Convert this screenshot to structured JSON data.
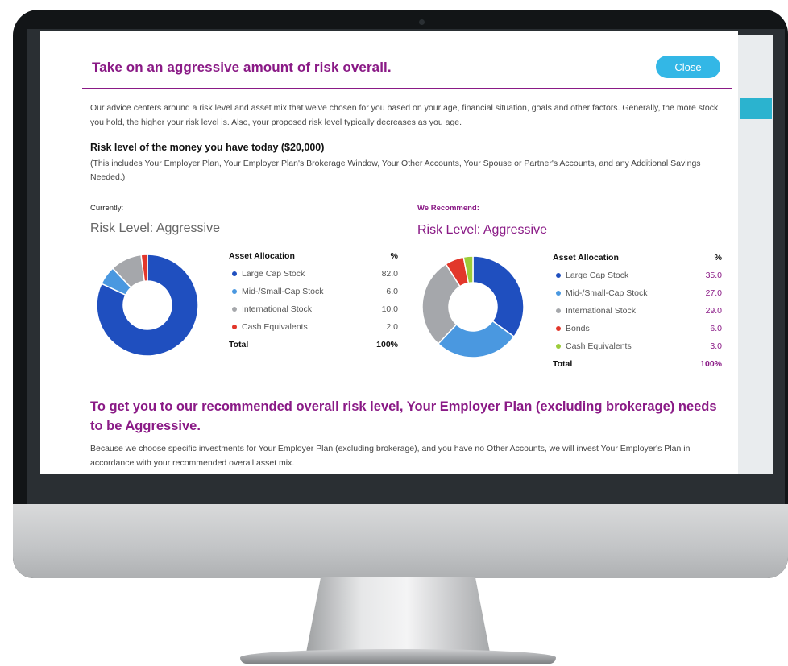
{
  "modal": {
    "title": "Take on an aggressive amount of risk overall.",
    "close_label": "Close",
    "intro": "Our advice centers around a risk level and asset mix that we've chosen for you based on your age, financial situation, goals and other factors. Generally, the more stock you hold, the higher your risk level is. Also, your proposed risk level typically decreases as you age.",
    "section_heading": "Risk level of the money you have today ($20,000)",
    "section_note": "(This includes Your Employer Plan, Your Employer Plan's Brokerage Window, Your Other Accounts, Your Spouse or Partner's Accounts, and any Additional Savings Needed.)",
    "recommend_heading": "To get you to our recommended overall risk level, Your Employer Plan (excluding brokerage) needs to be Aggressive.",
    "footer_text": "Because we choose specific investments for Your Employer Plan (excluding brokerage), and you have no Other Accounts, we will invest Your Employer's Plan in accordance with your recommended overall asset mix."
  },
  "current": {
    "label": "Currently:",
    "risk_level": "Risk Level: Aggressive",
    "table_header": "Asset Allocation",
    "pct_header": "%",
    "total_label": "Total",
    "total_value": "100%",
    "rows": [
      {
        "name": "Large Cap Stock",
        "pct": "82.0",
        "value": 82.0,
        "color": "#1f4fbf"
      },
      {
        "name": "Mid-/Small-Cap Stock",
        "pct": "6.0",
        "value": 6.0,
        "color": "#4a98e0"
      },
      {
        "name": "International Stock",
        "pct": "10.0",
        "value": 10.0,
        "color": "#a5a7ab"
      },
      {
        "name": "Cash Equivalents",
        "pct": "2.0",
        "value": 2.0,
        "color": "#e2372b"
      }
    ]
  },
  "recommended": {
    "label": "We Recommend:",
    "risk_level": "Risk Level: Aggressive",
    "table_header": "Asset Allocation",
    "pct_header": "%",
    "total_label": "Total",
    "total_value": "100%",
    "rows": [
      {
        "name": "Large Cap Stock",
        "pct": "35.0",
        "value": 35.0,
        "color": "#1f4fbf"
      },
      {
        "name": "Mid-/Small-Cap Stock",
        "pct": "27.0",
        "value": 27.0,
        "color": "#4a98e0"
      },
      {
        "name": "International Stock",
        "pct": "29.0",
        "value": 29.0,
        "color": "#a5a7ab"
      },
      {
        "name": "Bonds",
        "pct": "6.0",
        "value": 6.0,
        "color": "#e2372b"
      },
      {
        "name": "Cash Equivalents",
        "pct": "3.0",
        "value": 3.0,
        "color": "#9ccc3a"
      }
    ]
  },
  "colors": {
    "accent_purple": "#8a1a86",
    "close_button": "#33b7e6"
  }
}
